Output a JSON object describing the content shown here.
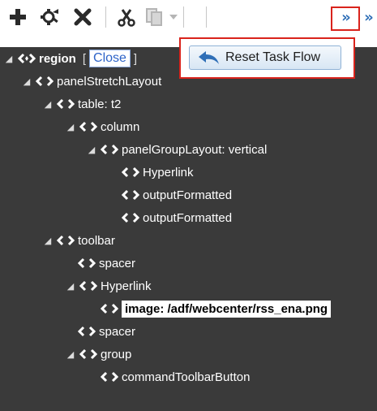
{
  "toolbar": {
    "icons": [
      "add-icon",
      "settings-icon",
      "delete-icon",
      "cut-icon",
      "copy-icon",
      "dropdown-icon"
    ],
    "more_label": "»",
    "more2_label": "»"
  },
  "popup": {
    "button_label": "Reset Task Flow"
  },
  "tree": {
    "region": {
      "label": "region",
      "bracket_open": "[",
      "close_link": "Close",
      "bracket_close": "]"
    },
    "nodes": [
      {
        "label": "panelStretchLayout"
      },
      {
        "label": "table: t2"
      },
      {
        "label": "column"
      },
      {
        "label": "panelGroupLayout: vertical"
      },
      {
        "label": "Hyperlink"
      },
      {
        "label": "outputFormatted"
      },
      {
        "label": "outputFormatted"
      },
      {
        "label": "toolbar"
      },
      {
        "label": "spacer"
      },
      {
        "label": "Hyperlink"
      },
      {
        "label": "image: /adf/webcenter/rss_ena.png"
      },
      {
        "label": "spacer"
      },
      {
        "label": "group"
      },
      {
        "label": "commandToolbarButton"
      }
    ]
  }
}
